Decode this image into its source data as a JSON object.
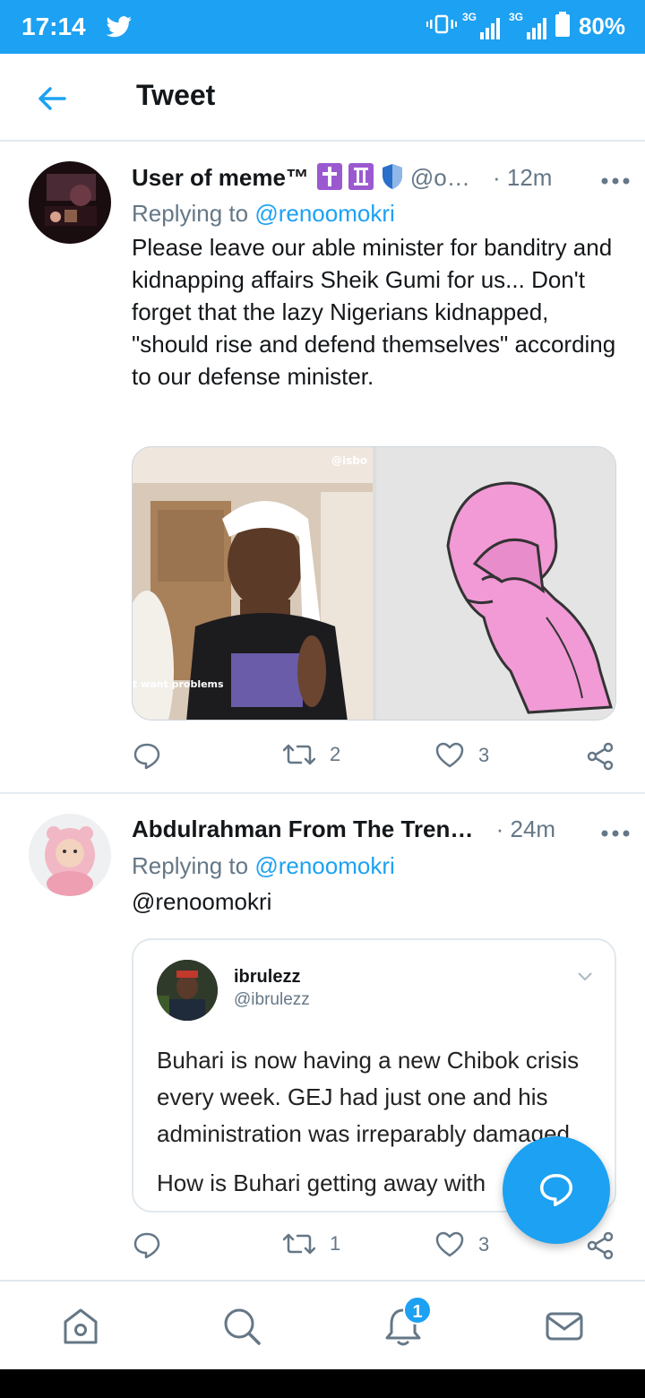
{
  "status_bar": {
    "time": "17:14",
    "signal_label_1": "3G",
    "signal_label_2": "3G",
    "battery": "80%",
    "background": "#1da1f2"
  },
  "header": {
    "title": "Tweet",
    "back_icon": "arrow-left-icon"
  },
  "tweets": [
    {
      "display_name": "User of meme™",
      "handle": "@o…",
      "time": "· 12m",
      "replying_prefix": "Replying to",
      "replying_to": "@renoomokri",
      "text": "Please leave our able minister for banditry and kidnapping affairs Sheik Gumi for us... Don't forget that the lazy Nigerians kidnapped, \"should rise and defend themselves\" according to our defense minister.",
      "media_watermark": "@isbo",
      "media_caption": "t want problems",
      "retweets": "2",
      "likes": "3"
    },
    {
      "display_name": "Abdulrahman From The Tren…",
      "time": "· 24m",
      "replying_prefix": "Replying to",
      "replying_to": "@renoomokri",
      "text": "@renoomokri",
      "quote": {
        "name": "ibrulezz",
        "handle": "@ibrulezz",
        "text": "Buhari is now having a new Chibok crisis every week. GEJ had just one and his administration was irreparably damaged.",
        "text_cut": "How is Buhari getting away with"
      },
      "retweets": "1",
      "likes": "3"
    }
  ],
  "bottom_nav": {
    "items": [
      "home-icon",
      "search-icon",
      "notifications-icon",
      "messages-icon"
    ],
    "notification_badge": "1"
  },
  "colors": {
    "accent": "#1da1f2",
    "muted": "#657786",
    "text": "#14171a"
  }
}
